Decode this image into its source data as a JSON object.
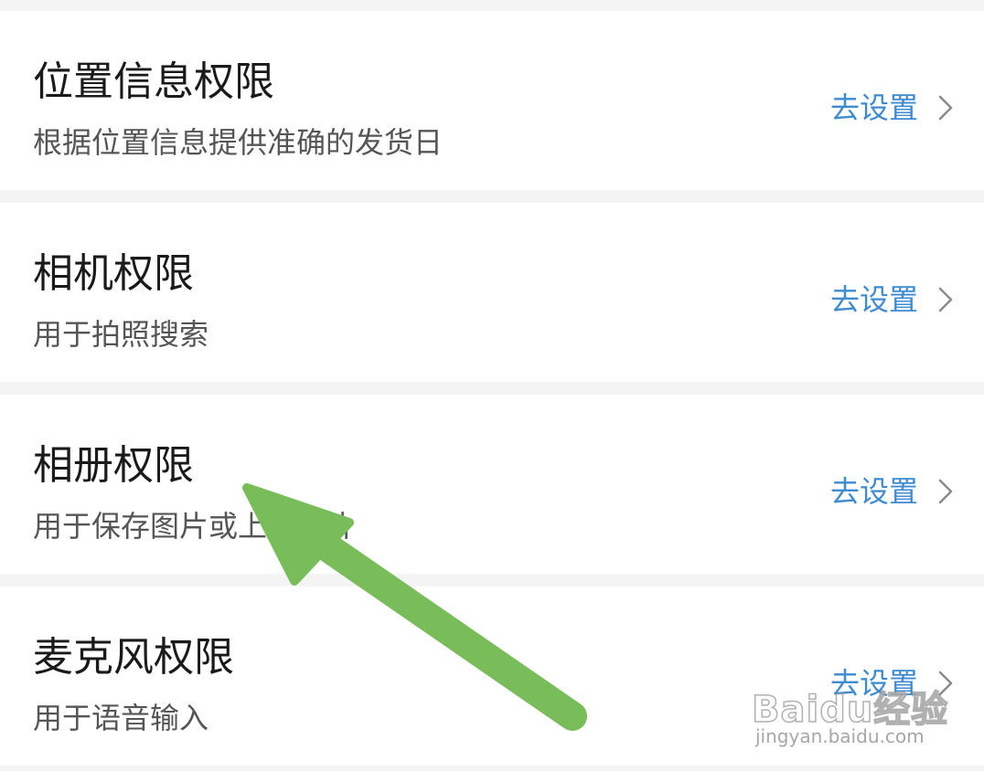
{
  "permissions": [
    {
      "title": "位置信息权限",
      "desc": "根据位置信息提供准确的发货日",
      "action": "去设置"
    },
    {
      "title": "相机权限",
      "desc": "用于拍照搜索",
      "action": "去设置"
    },
    {
      "title": "相册权限",
      "desc": "用于保存图片或上传图片",
      "action": "去设置"
    },
    {
      "title": "麦克风权限",
      "desc": "用于语音输入",
      "action": "去设置"
    }
  ],
  "icons": {
    "chevron": "chevron-right-icon",
    "annotation": "arrow-icon"
  },
  "colors": {
    "page_bg": "#f4f4f4",
    "card_bg": "#ffffff",
    "title": "#1a1a1a",
    "desc": "#555555",
    "action": "#3d8bd1",
    "chevron": "#8a8a8a",
    "annotation_arrow": "#78bd5a"
  },
  "watermark": {
    "brand": "Baidu经验",
    "url": "jingyan.baidu.com"
  }
}
